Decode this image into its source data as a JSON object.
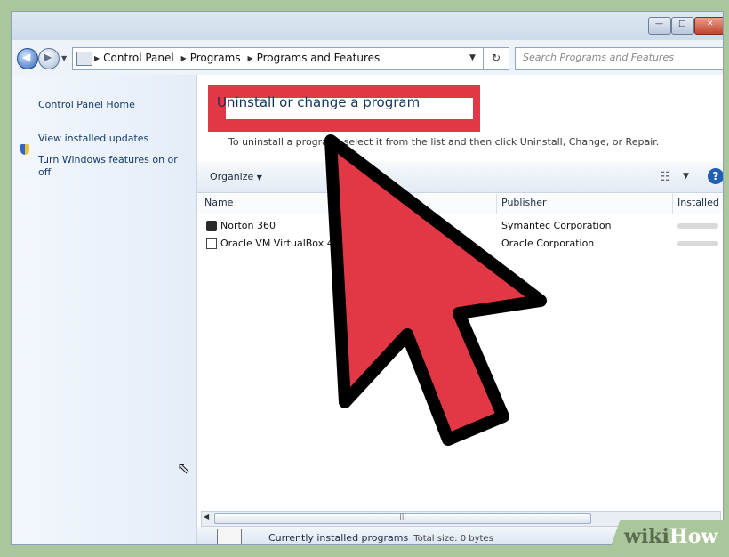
{
  "window": {
    "minimize_icon": "minimize-icon",
    "maximize_icon": "maximize-icon",
    "close_icon": "close-icon"
  },
  "address": {
    "breadcrumbs": [
      "Control Panel",
      "Programs",
      "Programs and Features"
    ],
    "search_placeholder": "Search Programs and Features"
  },
  "sidebar": {
    "links": [
      "Control Panel Home",
      "View installed updates",
      "Turn Windows features on or off"
    ]
  },
  "main": {
    "title": "Uninstall or change a program",
    "instruction": "To uninstall a program, select it from the list and then click Uninstall, Change, or Repair.",
    "organize_label": "Organize",
    "columns": [
      "Name",
      "Publisher",
      "Installed On"
    ],
    "programs": [
      {
        "name": "Norton 360",
        "publisher": "Symantec Corporation",
        "icon": "norton-icon"
      },
      {
        "name": "Oracle VM VirtualBox 4.2.6",
        "publisher": "Oracle Corporation",
        "icon": "virtualbox-icon"
      }
    ],
    "details": {
      "label": "Currently installed programs",
      "size_text": "Total size: 0 bytes"
    }
  },
  "overlay": {
    "arrow_color": "#e23745",
    "highlight_color": "#e23745"
  },
  "watermark": {
    "prefix": "wiki",
    "suffix": "How"
  }
}
